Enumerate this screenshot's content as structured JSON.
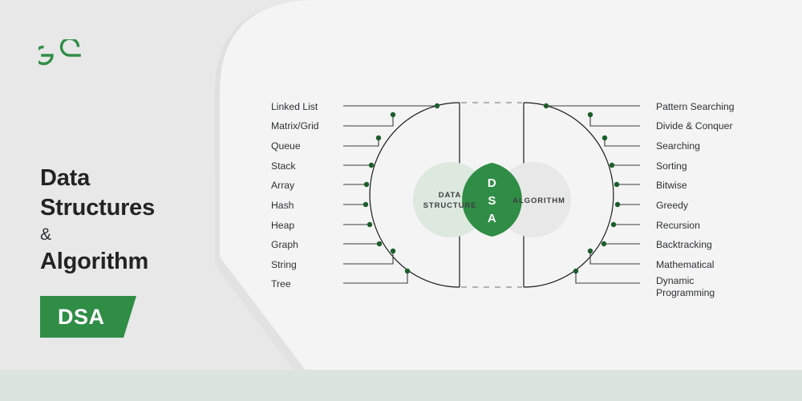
{
  "theme": {
    "background": "#E8E8E8",
    "panel": "#F4F4F4",
    "bottom_strip": "#DCE5DD",
    "brand_green": "#2F8D46",
    "logo_green": "#2F8D46",
    "text_dark": "#232323",
    "label_text": "#2f3032",
    "dot_green": "#1b5e2b",
    "circle_left_fill": "#DDE8DE",
    "circle_right_fill": "#E8E8E8",
    "lens_fill": "#2F8D46"
  },
  "brand": {
    "logo_name": "geeksforgeeks-logo",
    "logo_alt": "GeeksforGeeks"
  },
  "headline": {
    "line1": "Data",
    "line2": "Structures",
    "ampersand": "&",
    "line3": "Algorithm"
  },
  "badge": {
    "label": "DSA"
  },
  "diagram": {
    "venn": {
      "left_circle_line1": "DATA",
      "left_circle_line2": "STRUCTURE",
      "right_circle_label": "ALGORITHM",
      "lens_letters": [
        "D",
        "S",
        "A"
      ]
    },
    "left_labels": [
      "Linked List",
      "Matrix/Grid",
      "Queue",
      "Stack",
      "Array",
      "Hash",
      "Heap",
      "Graph",
      "String",
      "Tree"
    ],
    "right_labels": [
      "Pattern Searching",
      "Divide & Conquer",
      "Searching",
      "Sorting",
      "Bitwise",
      "Greedy",
      "Recursion",
      "Backtracking",
      "Mathematical",
      "Dynamic\nProgramming"
    ]
  }
}
